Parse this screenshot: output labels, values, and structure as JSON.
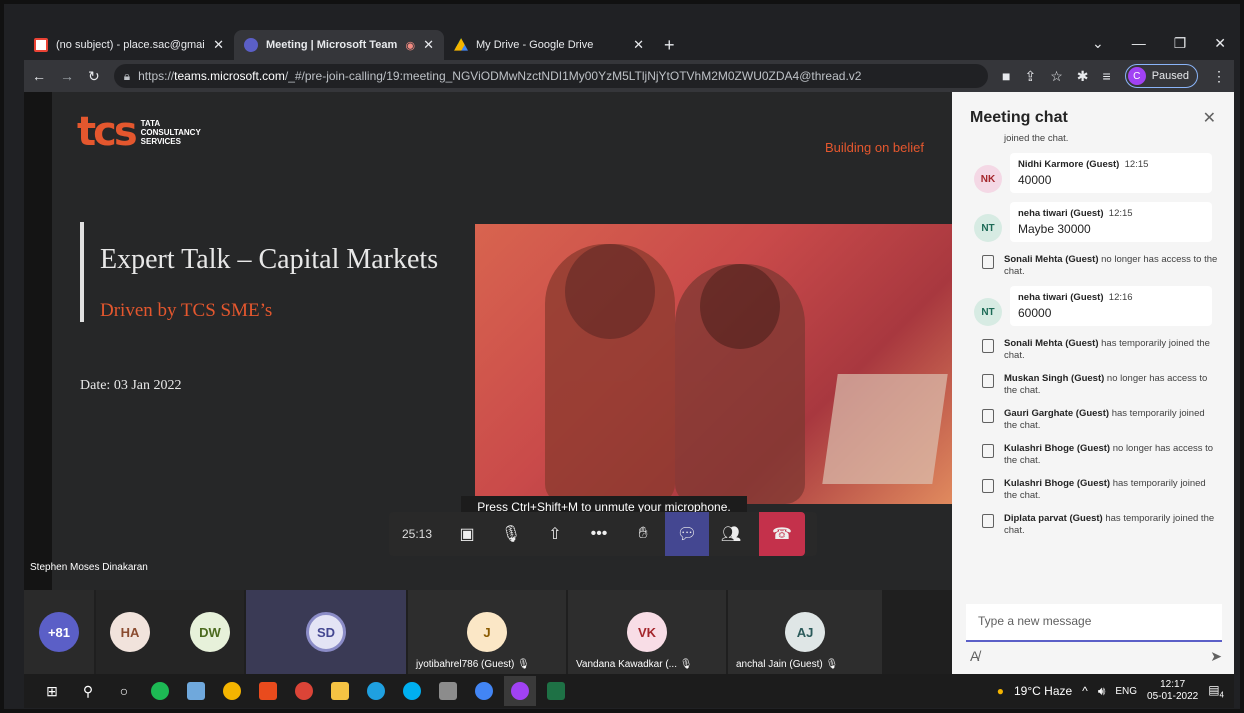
{
  "browser": {
    "tabs": [
      {
        "title": "(no subject) - place.sac@gmail.co",
        "icon": "gmail-icon",
        "active": false
      },
      {
        "title": "Meeting | Microsoft Teams",
        "icon": "teams-icon",
        "active": true
      },
      {
        "title": "My Drive - Google Drive",
        "icon": "google-drive-icon",
        "active": false
      }
    ],
    "url": {
      "scheme": "https://",
      "host": "teams.microsoft.com",
      "path": "/_#/pre-join-calling/19:meeting_NGViODMwNzctNDI1My00YzM5LTljNjYtOTVhM2M0ZWU0ZDA4@thread.v2"
    },
    "profile_initial": "C",
    "profile_status": "Paused"
  },
  "slide": {
    "logo_mark": "tcs",
    "logo_words": [
      "TATA",
      "CONSULTANCY",
      "SERVICES"
    ],
    "tagline": "Building on belief",
    "title": "Expert Talk – Capital Markets",
    "subtitle": "Driven by TCS SME’s",
    "date": "Date: 03 Jan 2022",
    "speaker": "Stephen Moses Dinakaran"
  },
  "call": {
    "toast": "Press Ctrl+Shift+M to unmute your microphone.",
    "timer": "25:13",
    "participants": [
      {
        "initials": "+81",
        "bg": "#5b5fc7",
        "fg": "#ffffff",
        "name": ""
      },
      {
        "initials": "HA",
        "bg": "#f1e3dc",
        "fg": "#8a4b2f",
        "name": ""
      },
      {
        "initials": "DW",
        "bg": "#e7f1da",
        "fg": "#4c6b1f",
        "name": ""
      },
      {
        "initials": "SD",
        "bg": "#e4e4f5",
        "fg": "#444791",
        "name": ""
      },
      {
        "initials": "J",
        "bg": "#fbe7c6",
        "fg": "#8a5a00",
        "name": "jyotibahrel786 (Guest)"
      },
      {
        "initials": "VK",
        "bg": "#f8dde6",
        "fg": "#a4262c",
        "name": "Vandana Kawadkar (..."
      },
      {
        "initials": "AJ",
        "bg": "#dfe6e6",
        "fg": "#2b5a5a",
        "name": "anchal Jain (Guest)"
      }
    ]
  },
  "chat": {
    "title": "Meeting chat",
    "top_fragment": "joined the chat.",
    "entries": [
      {
        "type": "msg",
        "initials": "NK",
        "avbg": "#f4d8e5",
        "avfg": "#a4262c",
        "who": "Nidhi Karmore (Guest)",
        "time": "12:15",
        "text": "40000"
      },
      {
        "type": "msg",
        "initials": "NT",
        "avbg": "#d7ebe3",
        "avfg": "#1d6a56",
        "who": "neha tiwari (Guest)",
        "time": "12:15",
        "text": "Maybe 30000"
      },
      {
        "type": "sys",
        "who": "Sonali Mehta (Guest)",
        "text": " no longer has access to the chat."
      },
      {
        "type": "msg",
        "initials": "NT",
        "avbg": "#d7ebe3",
        "avfg": "#1d6a56",
        "who": "neha tiwari (Guest)",
        "time": "12:16",
        "text": "60000"
      },
      {
        "type": "sys",
        "who": "Sonali Mehta (Guest)",
        "text": " has temporarily joined the chat."
      },
      {
        "type": "sys",
        "who": "Muskan Singh (Guest)",
        "text": " no longer has access to the chat."
      },
      {
        "type": "sys",
        "who": "Gauri Garghate (Guest)",
        "text": " has temporarily joined the chat."
      },
      {
        "type": "sys",
        "who": "Kulashri Bhoge (Guest)",
        "text": " no longer has access to the chat."
      },
      {
        "type": "sys",
        "who": "Kulashri Bhoge (Guest)",
        "text": " has temporarily joined the chat."
      },
      {
        "type": "sys",
        "who": "Diplata parvat (Guest)",
        "text": " has temporarily joined the chat."
      }
    ],
    "compose_placeholder": "Type a new message"
  },
  "taskbar": {
    "weather": "19°C  Haze",
    "lang": "ENG",
    "time": "12:17",
    "date": "05-01-2022",
    "notifications": "4",
    "apps": [
      "windows-start-icon",
      "search-icon",
      "cortana-icon",
      "spotify-icon",
      "notes-icon",
      "chrome-icon",
      "office-icon",
      "chrome-profile-icon",
      "file-explorer-icon",
      "edge-icon",
      "skype-icon",
      "calculator-icon",
      "chrome-profile-icon",
      "chrome-profile-icon",
      "excel-icon"
    ]
  }
}
